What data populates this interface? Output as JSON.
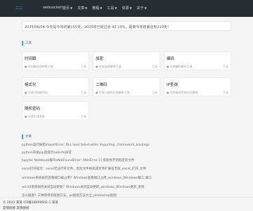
{
  "nav": {
    "logo": "二二",
    "site_name": "websocket!",
    "menu": [
      {
        "label": "首页"
      },
      {
        "label": "文章"
      },
      {
        "label": "教程"
      },
      {
        "label": "工具"
      },
      {
        "label": "资源"
      },
      {
        "label": "关于"
      }
    ]
  },
  "notice": "2025/06/04·今天是今年的第155天，2025年已经过去 42.19%，距离今年结束还有210天！",
  "sections": {
    "tools_title": "工具",
    "articles_title": "文章"
  },
  "tools": [
    {
      "name": "时间戳",
      "desc": "● 时间戳在线转换工具",
      "count": "工具"
    },
    {
      "name": "加密",
      "desc": "● 在线加密解密工具",
      "count": "工具"
    },
    {
      "name": "编码",
      "desc": "● 在线编码解码工具",
      "count": "工具"
    },
    {
      "name": "格式化",
      "desc": "● 在线代码格式化",
      "count": "工具"
    },
    {
      "name": "二维码",
      "desc": "● 在线二维码生成解析工具",
      "count": "工具"
    },
    {
      "name": "IP查询",
      "desc": "● 在线查询IP地址归属地",
      "count": "工具"
    },
    {
      "name": "随机密码",
      "desc": "● 在线生成密码",
      "count": "工具"
    }
  ],
  "articles": [
    "python运行报错ImportError: DLL load failed while importing _framework_bindings",
    "python升级pip后提示subinfo异常",
    "Jupyter Notebook报FileNotFoundError: [WinError 2] 系统找不到指定的文件",
    "excel打开提示：excel无法打开文件，因为文件格式或文件扩展名无效_excel_打开_文件",
    "windows系统如何查看端口被占用？Windows查看端口占用_windows_Windows端口_端口",
    "win10系统如何关闭自动更新？Windows关闭自动更新_windows_Windows更新_系统",
    "怎么抠图？三种简单的抠图方法，ps抠图方法大全_photoshop抠图"
  ],
  "footer": {
    "copyright": "© 2023 某某 ICP备18059602-1 某某",
    "links": "友情链接 友情链接"
  }
}
